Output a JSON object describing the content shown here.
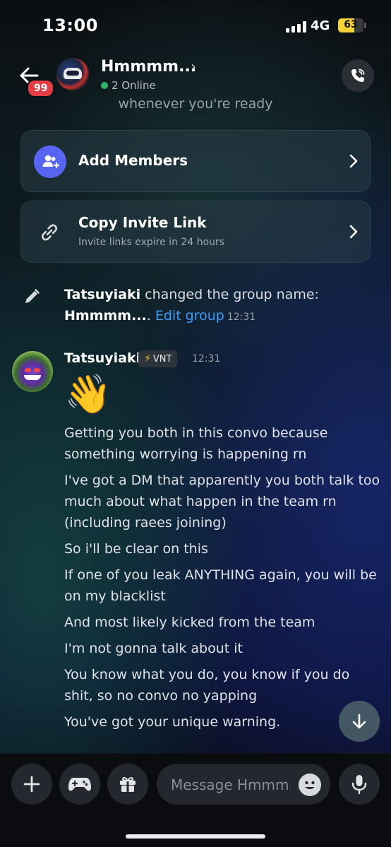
{
  "status_bar": {
    "time": "13:00",
    "network": "4G",
    "battery": "63"
  },
  "header": {
    "unread_badge": "99",
    "group_name": "Hmmmm...",
    "chevron": "›",
    "online": "2 Online",
    "call_icon": "phone-call-icon"
  },
  "cutoff_text": "whenever you're ready",
  "cards": {
    "add_members": {
      "label": "Add Members",
      "icon": "add-member-icon"
    },
    "copy_invite": {
      "label": "Copy Invite Link",
      "sub": "Invite links expire in 24 hours",
      "icon": "link-icon"
    }
  },
  "system_message": {
    "user": "Tatsuyiaki",
    "text": " changed the group name:",
    "new_name": "Hmmmm...",
    "separator": ". ",
    "edit_link": "Edit group",
    "time": "12:31"
  },
  "message": {
    "author": "Tatsuyiaki",
    "tag_icon": "⚡",
    "tag": "VNT",
    "time": "12:31",
    "emoji": "👋",
    "lines": [
      "Getting you both in this convo because something worrying is happening rn",
      "I've got a DM that apparently you both talk too much about what happen in the team rn (including raees joining)",
      "So i'll be clear on this",
      "If one of you leak ANYTHING again, you will be on my blacklist",
      "And most likely kicked from the team",
      "I'm not gonna talk about it",
      "You know what you do, you know if you do shit, so no convo no yapping",
      "You've got your unique warning."
    ]
  },
  "composer": {
    "placeholder": "Message Hmmm..."
  },
  "colors": {
    "accent": "#5865f2",
    "link": "#3d9cf5",
    "badge": "#e23d44",
    "online": "#2fb56a"
  }
}
